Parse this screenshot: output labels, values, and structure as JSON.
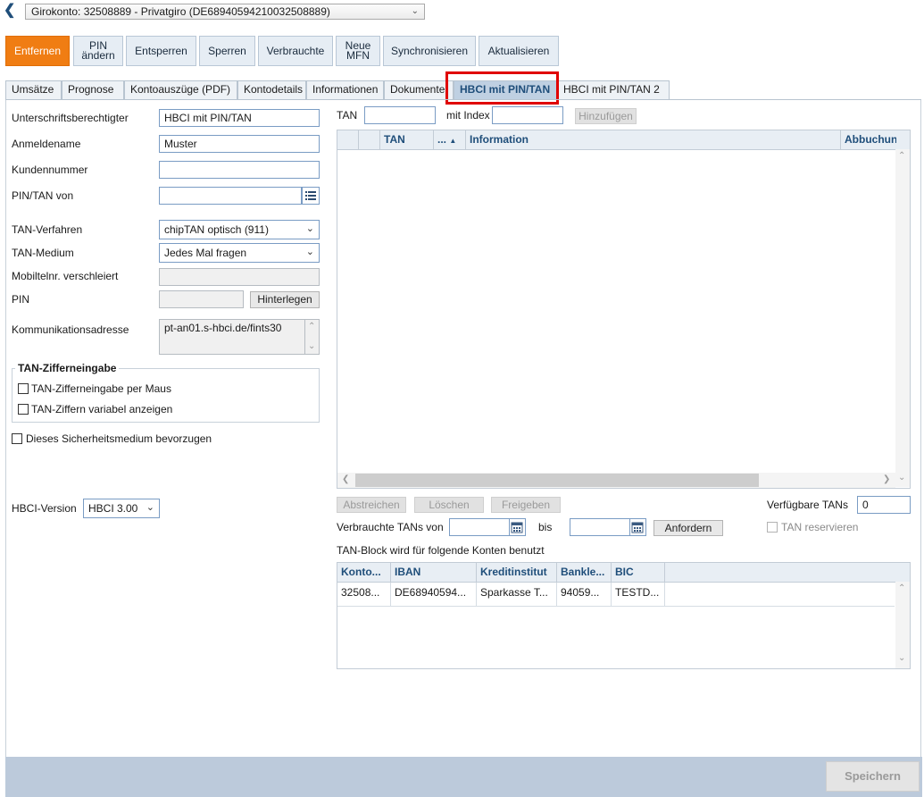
{
  "header": {
    "back_icon": "chevron-left-icon",
    "account_select": "Girokonto: 32508889 - Privatgiro (DE68940594210032508889)"
  },
  "toolbar": {
    "remove": "Entfernen",
    "pin_change": "PIN ändern",
    "unlock": "Entsperren",
    "lock": "Sperren",
    "used": "Verbrauchte",
    "new_mfn": "Neue MFN",
    "sync": "Synchronisieren",
    "refresh": "Aktualisieren",
    "accent_color": "#f07d13"
  },
  "tabs": [
    "Umsätze",
    "Prognose",
    "Kontoauszüge (PDF)",
    "Kontodetails",
    "Informationen",
    "Dokumente",
    "HBCI mit PIN/TAN",
    "HBCI mit PIN/TAN 2"
  ],
  "active_tab": "HBCI mit PIN/TAN",
  "highlight_color": "#e00000",
  "form": {
    "signatory_label": "Unterschriftsberechtigter",
    "signatory_value": "HBCI mit PIN/TAN",
    "login_label": "Anmeldename",
    "login_value": "Muster",
    "customer_label": "Kundennummer",
    "customer_value": "",
    "pintan_label": "PIN/TAN von",
    "pintan_value": "",
    "tan_method_label": "TAN-Verfahren",
    "tan_method_value": "chipTAN optisch (911)",
    "tan_medium_label": "TAN-Medium",
    "tan_medium_value": "Jedes Mal fragen",
    "mobile_label": "Mobiltelnr. verschleiert",
    "mobile_value": "",
    "pin_label": "PIN",
    "pin_value": "",
    "store_button": "Hinterlegen",
    "address_label": "Kommunikationsadresse",
    "address_value": "pt-an01.s-hbci.de/fints30",
    "group_title": "TAN-Zifferneingabe",
    "mouse_entry": "TAN-Zifferneingabe per Maus",
    "variable_digits": "TAN-Ziffern variabel anzeigen",
    "prefer_medium": "Dieses Sicherheitsmedium bevorzugen",
    "hbci_version_label": "HBCI-Version",
    "hbci_version_value": "HBCI 3.00"
  },
  "tan_entry": {
    "tan_label": "TAN",
    "tan_value": "",
    "index_label": "mit Index",
    "index_value": "",
    "add_button": "Hinzufügen"
  },
  "tan_grid": {
    "columns": [
      "",
      "TAN",
      "...",
      "Information",
      "Abbuchun"
    ],
    "rows": []
  },
  "tan_actions": {
    "strike": "Abstreichen",
    "delete": "Löschen",
    "release": "Freigeben",
    "available_label": "Verfügbare TANs",
    "available_value": "0",
    "used_from_label": "Verbrauchte TANs von",
    "used_from_value": "",
    "to_label": "bis",
    "to_value": "",
    "request_button": "Anfordern",
    "reserve_label": "TAN reservieren"
  },
  "accounts": {
    "caption": "TAN-Block wird für folgende Konten benutzt",
    "columns": [
      "Konto...",
      "IBAN",
      "Kreditinstitut",
      "Bankle...",
      "BIC"
    ],
    "rows": [
      [
        "32508...",
        "DE68940594...",
        "Sparkasse T...",
        "94059...",
        "TESTD..."
      ]
    ]
  },
  "footer": {
    "save_button": "Speichern"
  }
}
